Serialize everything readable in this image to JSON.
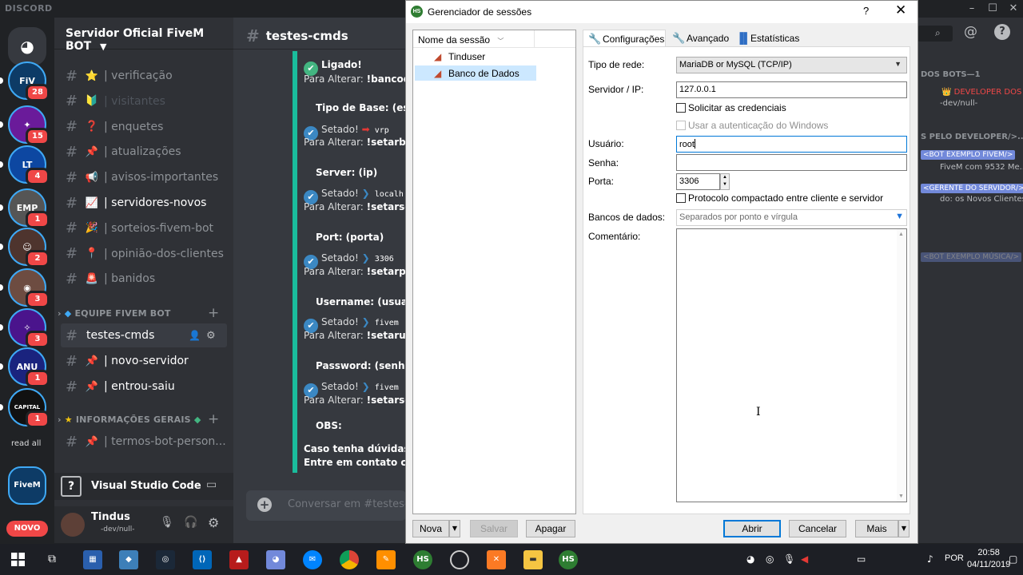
{
  "discord": {
    "brand": "DISCORD",
    "servers": [
      {
        "name": "home",
        "abbr": "",
        "badge": "",
        "color": "#36393f"
      },
      {
        "name": "fivem-bot",
        "abbr": "FiV",
        "badge": "28",
        "color": "#0d3b66"
      },
      {
        "name": "server-2",
        "abbr": "✦",
        "badge": "15",
        "color": "#6a1b9a"
      },
      {
        "name": "server-3",
        "abbr": "LT",
        "badge": "4",
        "color": "#0d47a1"
      },
      {
        "name": "server-4",
        "abbr": "EMP",
        "badge": "1",
        "color": "#555"
      },
      {
        "name": "server-5",
        "abbr": "☺",
        "badge": "2",
        "color": "#4e342e"
      },
      {
        "name": "server-6",
        "abbr": "◉",
        "badge": "3",
        "color": "#6d4c41"
      },
      {
        "name": "server-7",
        "abbr": "✧",
        "badge": "3",
        "color": "#4a148c"
      },
      {
        "name": "server-8",
        "abbr": "ANU",
        "badge": "1",
        "color": "#1a237e"
      },
      {
        "name": "server-9",
        "abbr": "CAPITAL",
        "badge": "1",
        "color": "#111"
      }
    ],
    "read_all": "read all",
    "current_server_abbr": "FiveM",
    "novo": "NOVO",
    "server_name": "Servidor Oficial FiveM BOT",
    "channels_top": [
      {
        "emoji": "⭐",
        "name": "| verificação",
        "state": "normal"
      },
      {
        "emoji": "🔰",
        "name": "| visitantes",
        "state": "muted"
      },
      {
        "emoji": "❓",
        "name": "| enquetes",
        "state": "normal"
      },
      {
        "emoji": "📌",
        "name": "| atualizações",
        "state": "normal"
      },
      {
        "emoji": "📢",
        "name": "| avisos-importantes",
        "state": "normal"
      },
      {
        "emoji": "📈",
        "name": "| servidores-novos",
        "state": "unread"
      },
      {
        "emoji": "🎉",
        "name": "| sorteios-fivem-bot",
        "state": "normal"
      },
      {
        "emoji": "📍",
        "name": "| opinião-dos-clientes",
        "state": "normal"
      },
      {
        "emoji": "🚨",
        "name": "| banidos",
        "state": "normal"
      }
    ],
    "category_team": "EQUIPE FIVEM BOT",
    "team_channels": [
      {
        "emoji": "",
        "name": "testes-cmds",
        "state": "sel"
      },
      {
        "emoji": "📌",
        "name": "| novo-servidor",
        "state": "unread"
      },
      {
        "emoji": "📌",
        "name": "| entrou-saiu",
        "state": "unread"
      }
    ],
    "category_info": "INFORMAÇÕES GERAIS",
    "info_channels": [
      {
        "emoji": "📌",
        "name": "| termos-bot-person..."
      }
    ],
    "activity": "Visual Studio Code",
    "user": {
      "name": "Tindus",
      "status": "-dev/null-"
    },
    "chat": {
      "channel": "testes-cmds",
      "placeholder": "Conversar em #testes-",
      "lines": [
        {
          "kind": "ok",
          "text": "Ligado!"
        },
        {
          "kind": "txt",
          "pre": "Para Alterar: ",
          "bold": "!bancode"
        },
        {
          "kind": "head",
          "text": "Tipo de Base: (esse"
        },
        {
          "kind": "set",
          "text": "Setado! ",
          "val": "vrp"
        },
        {
          "kind": "txt",
          "pre": "Para Alterar: ",
          "bold": "!setarbase"
        },
        {
          "kind": "head",
          "text": "Server: (ip)"
        },
        {
          "kind": "set",
          "text": "Setado! ",
          "val": "localh"
        },
        {
          "kind": "txt",
          "pre": "Para Alterar: ",
          "bold": "!setarserv"
        },
        {
          "kind": "head",
          "text": "Port: (porta)"
        },
        {
          "kind": "set",
          "text": "Setado! ",
          "val": "3306"
        },
        {
          "kind": "txt",
          "pre": "Para Alterar: ",
          "bold": "!setarport"
        },
        {
          "kind": "head",
          "text": "Username: (usuario"
        },
        {
          "kind": "set",
          "text": "Setado! ",
          "val": "fivem"
        },
        {
          "kind": "txt",
          "pre": "Para Alterar: ",
          "bold": "!setarusu"
        },
        {
          "kind": "head",
          "text": "Password: (senha)"
        },
        {
          "kind": "set",
          "text": "Setado! ",
          "val": "fivem"
        },
        {
          "kind": "txt",
          "pre": "Para Alterar: ",
          "bold": "!setarsenh"
        },
        {
          "kind": "head",
          "text": "OBS:"
        },
        {
          "kind": "bold",
          "text": "Caso tenha dúvidas en"
        },
        {
          "kind": "bold",
          "text": "Entre em contato com"
        }
      ]
    },
    "members": [
      {
        "text": "DOS BOTS—1",
        "type": "head"
      },
      {
        "text": "👑 DEVELOPER DOS B",
        "type": "red"
      },
      {
        "text": "-dev/null-",
        "type": "muted"
      },
      {
        "text": "S PELO DEVELOPER/>...",
        "type": "head"
      },
      {
        "text": "<BOT EXEMPLO FIVEM/>",
        "type": "tag"
      },
      {
        "text": "FiveM com 9532 Me...",
        "type": "muted"
      },
      {
        "text": "<GERENTE DO SERVIDOR/>",
        "type": "tag"
      },
      {
        "text": "do: os Novos Clientes ...",
        "type": "muted"
      },
      {
        "text": "<BOT EXEMPLO MÚSICA/>",
        "type": "tagdim"
      }
    ]
  },
  "session_manager": {
    "title": "Gerenciador de sessões",
    "help": "?",
    "close": "✕",
    "tree_header": "Nome da sessão",
    "sessions": [
      {
        "name": "Tinduser",
        "selected": false
      },
      {
        "name": "Banco de Dados",
        "selected": true
      }
    ],
    "tabs": [
      "Configurações",
      "Avançado",
      "Estatísticas"
    ],
    "labels": {
      "network_type": "Tipo de rede:",
      "server_ip": "Servidor / IP:",
      "user": "Usuário:",
      "password": "Senha:",
      "port": "Porta:",
      "databases": "Bancos de dados:",
      "comment": "Comentário:"
    },
    "values": {
      "network_type": "MariaDB or MySQL (TCP/IP)",
      "server_ip": "127.0.0.1",
      "user": "root",
      "password": "",
      "port": "3306",
      "databases_placeholder": "Separados por ponto e vírgula",
      "comment": ""
    },
    "checkboxes": {
      "prompt_credentials": "Solicitar as credenciais",
      "windows_auth": "Usar a autenticação do Windows",
      "compressed": "Protocolo compactado entre cliente e servidor"
    },
    "buttons": {
      "new": "Nova",
      "save": "Salvar",
      "delete": "Apagar",
      "open": "Abrir",
      "cancel": "Cancelar",
      "more": "Mais"
    }
  },
  "taskbar": {
    "lang": "POR",
    "time": "20:58",
    "date": "04/11/2019"
  }
}
